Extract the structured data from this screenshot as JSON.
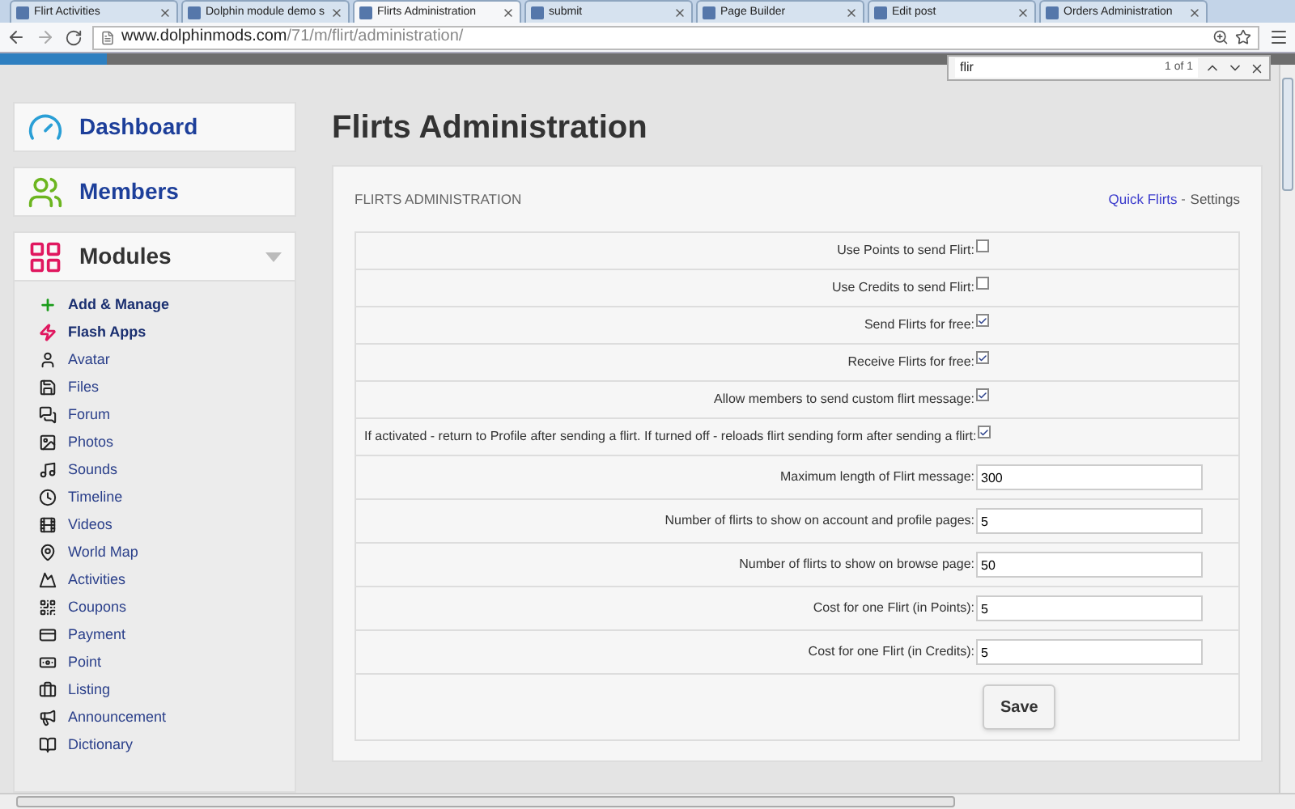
{
  "browser": {
    "tabs": [
      {
        "label": "Flirt Activities",
        "selected": false
      },
      {
        "label": "Dolphin module demo s",
        "selected": false
      },
      {
        "label": "Flirts Administration",
        "selected": true
      },
      {
        "label": "submit",
        "selected": false
      },
      {
        "label": "Page Builder",
        "selected": false
      },
      {
        "label": "Edit post",
        "selected": false
      },
      {
        "label": "Orders Administration",
        "selected": false
      }
    ],
    "url_host": "www.dolphinmods.com",
    "url_path": "/71/m/flirt/administration/",
    "find": {
      "query": "flir",
      "count": "1 of 1"
    }
  },
  "sidebar": {
    "sections": [
      {
        "label": "Dashboard",
        "expandable": false
      },
      {
        "label": "Members",
        "expandable": false
      },
      {
        "label": "Modules",
        "expandable": true
      }
    ],
    "items": [
      {
        "label": "Add & Manage",
        "kind": "action"
      },
      {
        "label": "Flash Apps",
        "kind": "action"
      },
      {
        "label": "Avatar",
        "kind": "module"
      },
      {
        "label": "Files",
        "kind": "module"
      },
      {
        "label": "Forum",
        "kind": "module"
      },
      {
        "label": "Photos",
        "kind": "module"
      },
      {
        "label": "Sounds",
        "kind": "module"
      },
      {
        "label": "Timeline",
        "kind": "module"
      },
      {
        "label": "Videos",
        "kind": "module"
      },
      {
        "label": "World Map",
        "kind": "module"
      },
      {
        "label": "Activities",
        "kind": "module"
      },
      {
        "label": "Coupons",
        "kind": "module"
      },
      {
        "label": "Payment",
        "kind": "module"
      },
      {
        "label": "Point",
        "kind": "module"
      },
      {
        "label": "Listing",
        "kind": "module"
      },
      {
        "label": "Announcement",
        "kind": "module"
      },
      {
        "label": "Dictionary",
        "kind": "module"
      }
    ]
  },
  "page_title": "Flirts Administration",
  "panel": {
    "heading": "FLIRTS ADMINISTRATION",
    "links": [
      {
        "label": "Quick Flirts",
        "selected": false
      },
      {
        "label": "Settings",
        "selected": true
      }
    ],
    "rows": [
      {
        "kind": "checkbox",
        "label": "Use Points to send Flirt:",
        "checked": false
      },
      {
        "kind": "checkbox",
        "label": "Use Credits to send Flirt:",
        "checked": false
      },
      {
        "kind": "checkbox",
        "label": "Send Flirts for free:",
        "checked": true
      },
      {
        "kind": "checkbox",
        "label": "Receive Flirts for free:",
        "checked": true
      },
      {
        "kind": "checkbox",
        "label": "Allow members to send custom flirt message:",
        "checked": true
      },
      {
        "kind": "checkbox",
        "label": "If activated - return to Profile after sending a flirt. If turned off - reloads flirt sending form after sending a flirt:",
        "checked": true
      },
      {
        "kind": "text",
        "label": "Maximum length of Flirt message:",
        "value": "300"
      },
      {
        "kind": "text",
        "label": "Number of flirts to show on account and profile pages:",
        "value": "5"
      },
      {
        "kind": "text",
        "label": "Number of flirts to show on browse page:",
        "value": "50"
      },
      {
        "kind": "text",
        "label": "Cost for one Flirt (in Points):",
        "value": "5"
      },
      {
        "kind": "text",
        "label": "Cost for one Flirt (in Credits):",
        "value": "5"
      }
    ],
    "save_button": "Save"
  }
}
